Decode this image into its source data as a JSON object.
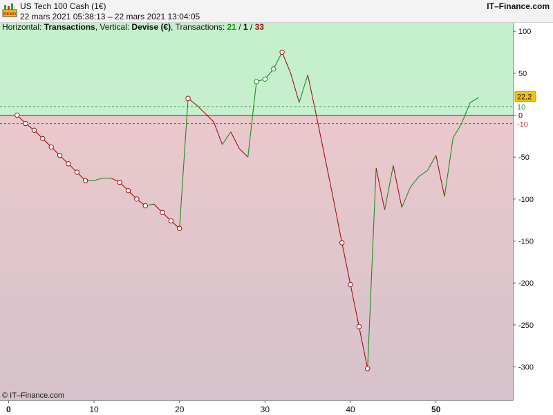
{
  "header": {
    "icon_text": "DEMO",
    "title": "US Tech 100 Cash (1€)",
    "dates": "22 mars 2021 05:38:13 – 22 mars 2021 13:04:05",
    "brand": "IT–Finance.com"
  },
  "info": {
    "horizontal_prefix": "Horizontal: ",
    "horizontal_value": "Transactions",
    "vertical_prefix": ", Vertical: ",
    "vertical_value": "Devise (€)",
    "transactions_prefix": ", Transactions: ",
    "winning": "21",
    "sep1": " / ",
    "neutral": "1",
    "sep2": " / ",
    "losing": "33"
  },
  "footer": {
    "copyright": "© IT–Finance.com"
  },
  "colors": {
    "profit_zone": "#c6efcd",
    "loss_zone": "#e6c6cc",
    "up_segment": "#1f8a1f",
    "down_segment": "#a00f0f",
    "zero_line": "#2b3fb0",
    "current_badge": "#f2c300"
  },
  "chart_data": {
    "type": "line",
    "title": "",
    "xlabel": "Transactions",
    "ylabel": "Devise (€)",
    "xlim": [
      -1,
      59
    ],
    "ylim": [
      -340,
      110
    ],
    "grid": false,
    "x_ticks": [
      0,
      10,
      20,
      30,
      40,
      50
    ],
    "x_tick_labels": [
      "0",
      "10",
      "20",
      "30",
      "40",
      "50"
    ],
    "x_ticks_bold": [
      true,
      false,
      false,
      false,
      false,
      true
    ],
    "y_ticks": [
      100,
      50,
      0,
      -50,
      -100,
      -150,
      -200,
      -250,
      -300
    ],
    "y_tick_labels": [
      "100",
      "50",
      "0",
      "-50",
      "-100",
      "-150",
      "-200",
      "-250",
      "-300"
    ],
    "upper_threshold": 10,
    "lower_threshold": -10,
    "upper_threshold_label": "10",
    "lower_threshold_label": "-10",
    "current_value": 22.2,
    "current_value_label": "22,2",
    "x": [
      1,
      2,
      3,
      4,
      5,
      6,
      7,
      8,
      9,
      10,
      11,
      12,
      13,
      14,
      15,
      16,
      17,
      18,
      19,
      20,
      21,
      22,
      23,
      24,
      25,
      26,
      27,
      28,
      29,
      30,
      31,
      32,
      33,
      34,
      35,
      36,
      37,
      38,
      39,
      40,
      41,
      42,
      43,
      44,
      45,
      46,
      47,
      48,
      49,
      50,
      51,
      52,
      53,
      54,
      55
    ],
    "values": [
      0,
      -10,
      -18,
      -28,
      -38,
      -48,
      -58,
      -68,
      -78,
      -78,
      -75,
      -75,
      -80,
      -90,
      -100,
      -108,
      -106,
      -116,
      -126,
      -135,
      20,
      12,
      2,
      -8,
      -35,
      -20,
      -40,
      -50,
      40,
      43,
      55,
      75,
      50,
      15,
      48,
      0,
      -50,
      -100,
      -152,
      -202,
      -252,
      -302,
      -63,
      -113,
      -60,
      -110,
      -86,
      -73,
      -66,
      -48,
      -97,
      -27,
      -10,
      15,
      21
    ],
    "markers": [
      1,
      2,
      3,
      4,
      5,
      6,
      7,
      8,
      9,
      13,
      14,
      15,
      16,
      18,
      19,
      20,
      21,
      29,
      30,
      31,
      32,
      39,
      40,
      41,
      42
    ]
  }
}
